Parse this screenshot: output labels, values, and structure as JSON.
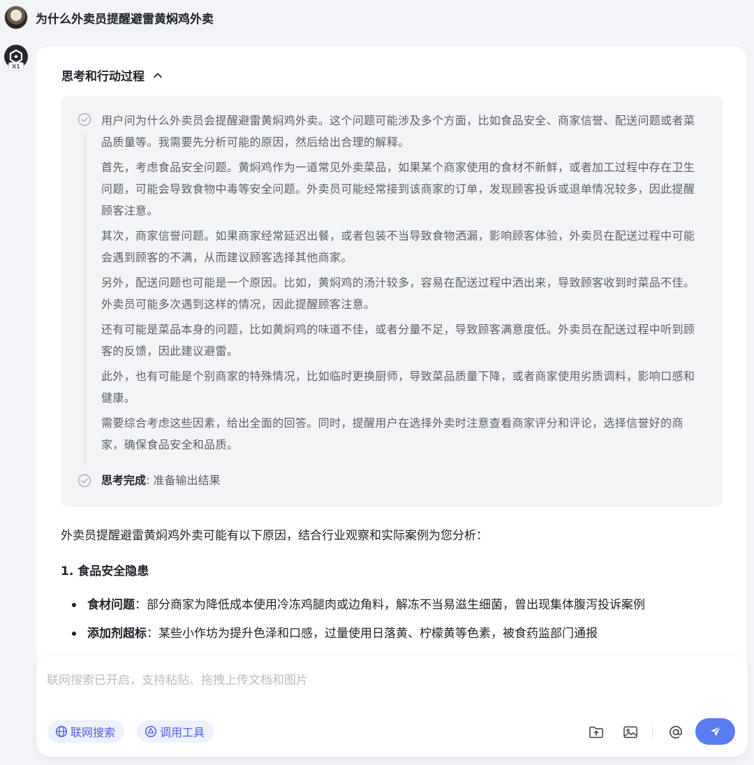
{
  "question": {
    "title": "为什么外卖员提醒避雷黄焖鸡外卖"
  },
  "bot": {
    "badge": "X1"
  },
  "process": {
    "header": "思考和行动过程",
    "paragraphs": [
      "用户问为什么外卖员会提醒避雷黄焖鸡外卖。这个问题可能涉及多个方面，比如食品安全、商家信誉、配送问题或者菜品质量等。我需要先分析可能的原因，然后给出合理的解释。",
      "首先，考虑食品安全问题。黄焖鸡作为一道常见外卖菜品，如果某个商家使用的食材不新鲜，或者加工过程中存在卫生问题，可能会导致食物中毒等安全问题。外卖员可能经常接到该商家的订单，发现顾客投诉或退单情况较多，因此提醒顾客注意。",
      "其次，商家信誉问题。如果商家经常延迟出餐，或者包装不当导致食物洒漏，影响顾客体验，外卖员在配送过程中可能会遇到顾客的不满，从而建议顾客选择其他商家。",
      "另外，配送问题也可能是一个原因。比如，黄焖鸡的汤汁较多，容易在配送过程中洒出来，导致顾客收到时菜品不佳。外卖员可能多次遇到这样的情况，因此提醒顾客注意。",
      "还有可能是菜品本身的问题，比如黄焖鸡的味道不佳，或者分量不足，导致顾客满意度低。外卖员在配送过程中听到顾客的反馈，因此建议避雷。",
      "此外，也有可能是个别商家的特殊情况，比如临时更换厨师，导致菜品质量下降，或者商家使用劣质调料，影响口感和健康。",
      "需要综合考虑这些因素，给出全面的回答。同时，提醒用户在选择外卖时注意查看商家评分和评论，选择信誉好的商家，确保食品安全和品质。"
    ],
    "done_label": "思考完成",
    "done_text": ": 准备输出结果"
  },
  "answer": {
    "intro": "外卖员提醒避雷黄焖鸡外卖可能有以下原因，结合行业观察和实际案例为您分析：",
    "section_title": "1. 食品安全隐患",
    "bullets": [
      {
        "label": "食材问题",
        "text": "：部分商家为降低成本使用冷冻鸡腿肉或边角料，解冻不当易滋生细菌，曾出现集体腹泻投诉案例"
      },
      {
        "label": "添加剂超标",
        "text": "：某些小作坊为提升色泽和口感，过量使用日落黄、柠檬黄等色素，被食药监部门通报"
      }
    ]
  },
  "composer": {
    "placeholder": "联网搜索已开启，支持粘贴、拖拽上传文档和图片",
    "web_search_label": "联网搜索",
    "tools_label": "调用工具"
  },
  "colors": {
    "accent": "#4e5fe0",
    "send_button": "#5b7cf0",
    "page_bg": "#f3f4f8",
    "thinking_bg": "#f3f4f6"
  }
}
